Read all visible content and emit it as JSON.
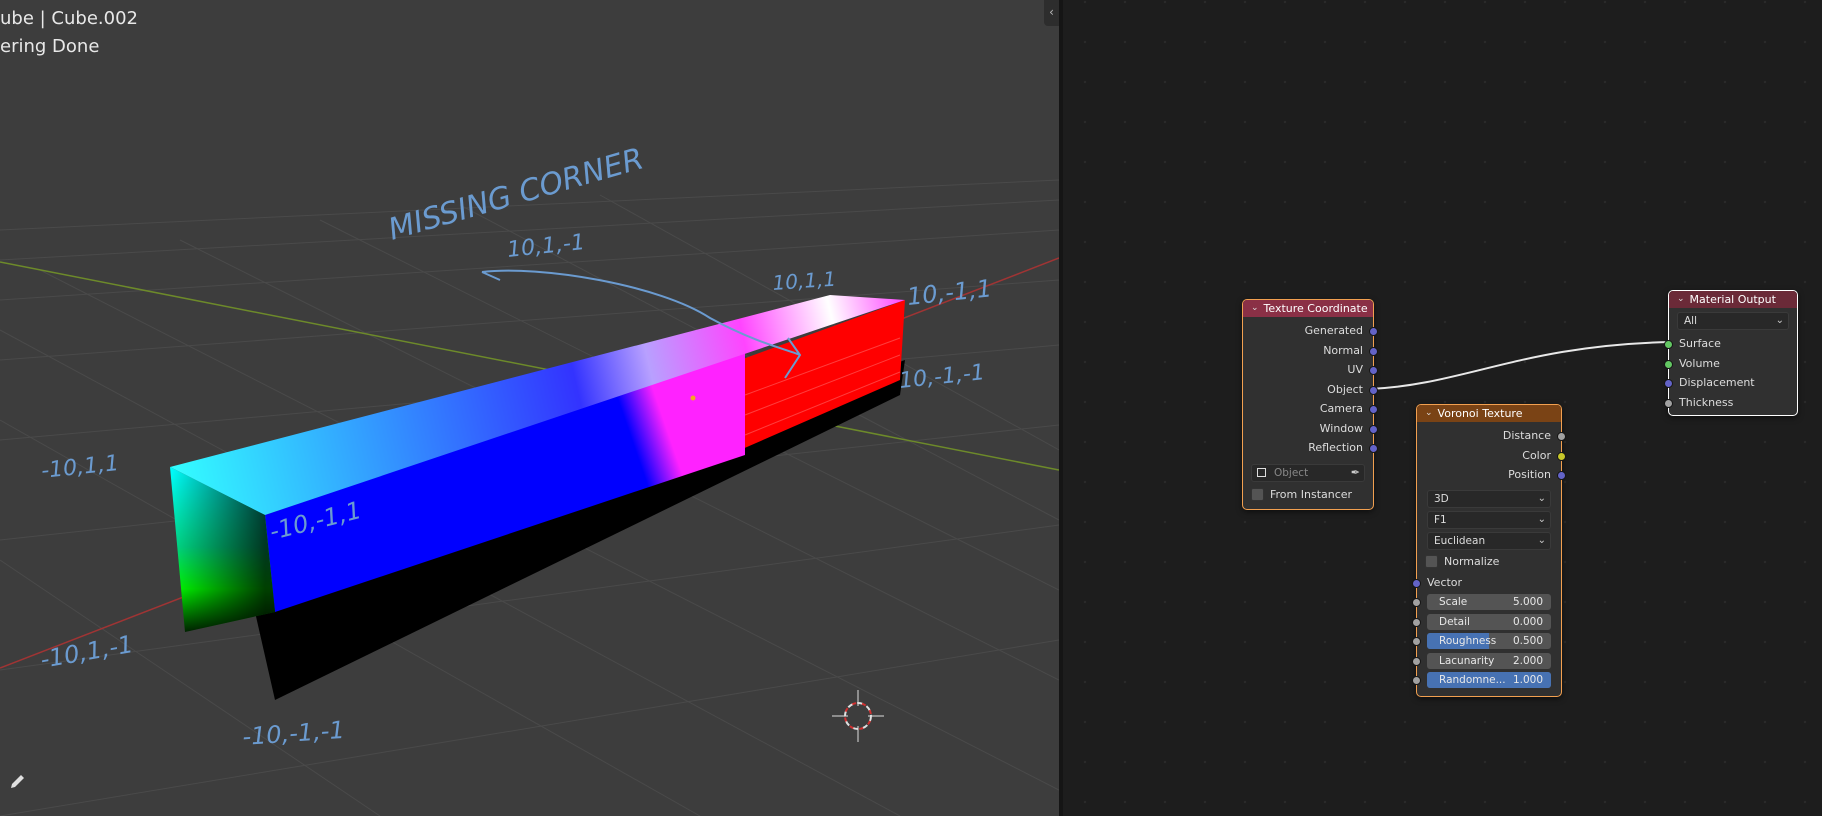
{
  "viewport": {
    "title": "ube | Cube.002",
    "status": "ering Done",
    "annotations": [
      {
        "text": "MISSING CORNER"
      },
      {
        "text": "10,1,-1"
      },
      {
        "text": "10,1,1"
      },
      {
        "text": "10,-1,1"
      },
      {
        "text": "10,-1,-1"
      },
      {
        "text": "-10,1,1"
      },
      {
        "text": "-10,-1,1"
      },
      {
        "text": "-10,1,-1"
      },
      {
        "text": "-10,-1,-1"
      }
    ]
  },
  "nodes": {
    "texture_coordinate": {
      "title": "Texture Coordinate",
      "header_color": "#8a3046",
      "outputs": [
        "Generated",
        "Normal",
        "UV",
        "Object",
        "Camera",
        "Window",
        "Reflection"
      ],
      "object_placeholder": "Object",
      "from_instancer": "From Instancer"
    },
    "voronoi": {
      "title": "Voronoi Texture",
      "header_color": "#7a4315",
      "outputs": [
        "Distance",
        "Color",
        "Position"
      ],
      "dimensions": "3D",
      "feature": "F1",
      "metric": "Euclidean",
      "normalize": "Normalize",
      "vector_label": "Vector",
      "fields": [
        {
          "label": "Scale",
          "value": "5.000",
          "fill": 0
        },
        {
          "label": "Detail",
          "value": "0.000",
          "fill": 0
        },
        {
          "label": "Roughness",
          "value": "0.500",
          "fill": 0.5
        },
        {
          "label": "Lacunarity",
          "value": "2.000",
          "fill": 0
        },
        {
          "label": "Randomne...",
          "value": "1.000",
          "fill": 1
        }
      ]
    },
    "material_output": {
      "title": "Material Output",
      "header_color": "#6b2a38",
      "target": "All",
      "inputs": [
        "Surface",
        "Volume",
        "Displacement",
        "Thickness"
      ]
    }
  },
  "colors": {
    "socket_vector": "#6363c7",
    "socket_color": "#c7c729",
    "socket_float": "#a1a1a1",
    "socket_shader": "#63c763",
    "annotation": "#6b9bd0"
  }
}
